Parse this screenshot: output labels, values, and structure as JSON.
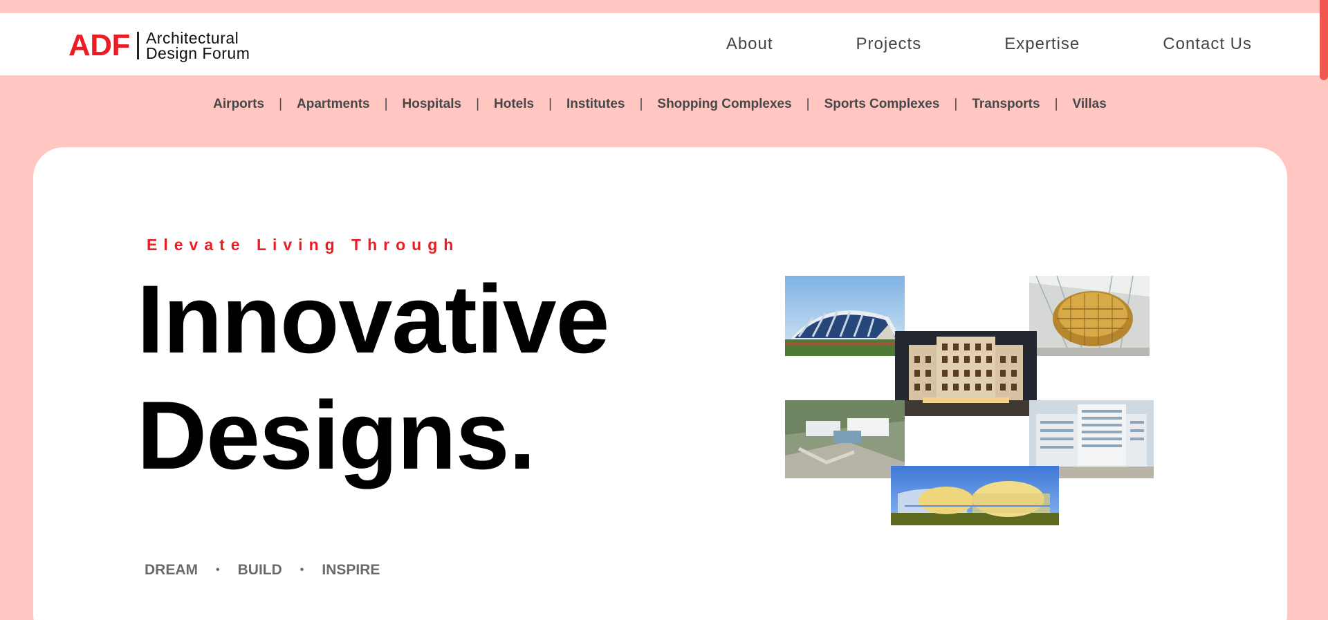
{
  "brand": {
    "mark": "ADF",
    "name_line1": "Architectural",
    "name_line2": "Design Forum",
    "accent_color": "#ec1c24"
  },
  "nav": [
    {
      "label": "About"
    },
    {
      "label": "Projects"
    },
    {
      "label": "Expertise"
    },
    {
      "label": "Contact Us"
    }
  ],
  "categories": [
    {
      "label": "Airports"
    },
    {
      "label": "Apartments"
    },
    {
      "label": "Hospitals"
    },
    {
      "label": "Hotels"
    },
    {
      "label": "Institutes"
    },
    {
      "label": "Shopping Complexes"
    },
    {
      "label": "Sports Complexes"
    },
    {
      "label": "Transports"
    },
    {
      "label": "Villas"
    }
  ],
  "category_separator": "|",
  "hero": {
    "tagline": "Elevate Living Through",
    "headline_line1": "Innovative",
    "headline_line2": "Designs.",
    "pillars": [
      "DREAM",
      "BUILD",
      "INSPIRE"
    ],
    "pillar_separator": "•"
  },
  "collage": [
    {
      "name": "stadium-photo"
    },
    {
      "name": "golden-dome-photo"
    },
    {
      "name": "hotel-tower-photo"
    },
    {
      "name": "campus-aerial-photo"
    },
    {
      "name": "hospital-building-photo"
    },
    {
      "name": "terminal-rendering-photo"
    }
  ],
  "colors": {
    "page_background": "#ffc6c2",
    "scrollbar": "#f2574f"
  }
}
